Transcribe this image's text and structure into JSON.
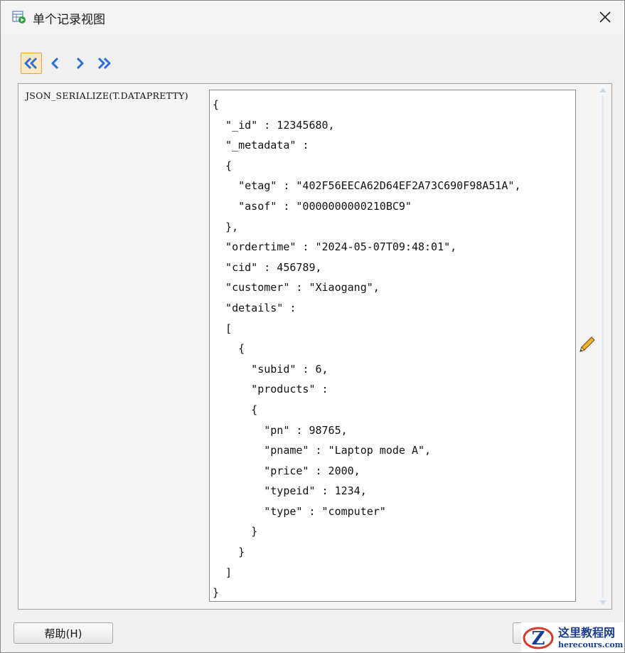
{
  "window": {
    "title": "单个记录视图",
    "icon": "record-view-icon"
  },
  "navigation": {
    "first_icon": "double-chevron-left-icon",
    "prev_icon": "chevron-left-icon",
    "next_icon": "chevron-right-icon",
    "last_icon": "double-chevron-right-icon"
  },
  "record": {
    "column_label": "JSON_SERIALIZE(T.DATAPRETTY)",
    "value": "{\n  \"_id\" : 12345680,\n  \"_metadata\" :\n  {\n    \"etag\" : \"402F56EECA62D64EF2A73C690F98A51A\",\n    \"asof\" : \"0000000000210BC9\"\n  },\n  \"ordertime\" : \"2024-05-07T09:48:01\",\n  \"cid\" : 456789,\n  \"customer\" : \"Xiaogang\",\n  \"details\" :\n  [\n    {\n      \"subid\" : 6,\n      \"products\" :\n      {\n        \"pn\" : 98765,\n        \"pname\" : \"Laptop mode A\",\n        \"price\" : 2000,\n        \"typeid\" : 1234,\n        \"type\" : \"computer\"\n      }\n    }\n  ]\n}",
    "edit_icon": "pencil-icon"
  },
  "footer": {
    "help_label": "帮助(H)"
  },
  "watermark": {
    "main": "这里教程网",
    "sub": "herecours.com"
  },
  "colors": {
    "accent_active": "#e8a33d",
    "nav_icon": "#2a6fd6",
    "watermark": "#1b3f8f"
  }
}
